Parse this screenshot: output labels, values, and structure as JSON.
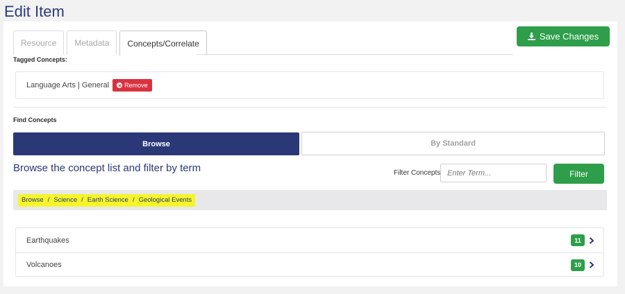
{
  "page": {
    "title": "Edit Item"
  },
  "tabs": [
    {
      "label": "Resource",
      "active": false
    },
    {
      "label": "Metadata",
      "active": false
    },
    {
      "label": "Concepts/Correlate",
      "active": true
    }
  ],
  "toolbar": {
    "save_label": "Save Changes",
    "save_icon": "download-icon"
  },
  "tagged": {
    "heading": "Tagged Concepts:",
    "items": [
      {
        "label": "Language Arts | General",
        "remove_label": "Remove"
      }
    ]
  },
  "find": {
    "heading": "Find Concepts",
    "modes": {
      "browse": "Browse",
      "standard": "By Standard",
      "selected": "Browse"
    },
    "browse_heading": "Browse the concept list and filter by term",
    "filter": {
      "label": "Filter Concepts",
      "placeholder": "Enter Term...",
      "value": "",
      "button": "Filter"
    },
    "breadcrumb": [
      "Browse",
      "Science",
      "Earth Science",
      "Geological Events"
    ],
    "concepts": [
      {
        "label": "Earthquakes",
        "count": "11"
      },
      {
        "label": "Volcanoes",
        "count": "10"
      }
    ]
  },
  "colors": {
    "brand_navy": "#2a3878",
    "success_green": "#2e9e4a",
    "danger_red": "#d9323f",
    "highlight_yellow": "#f5f52a"
  }
}
